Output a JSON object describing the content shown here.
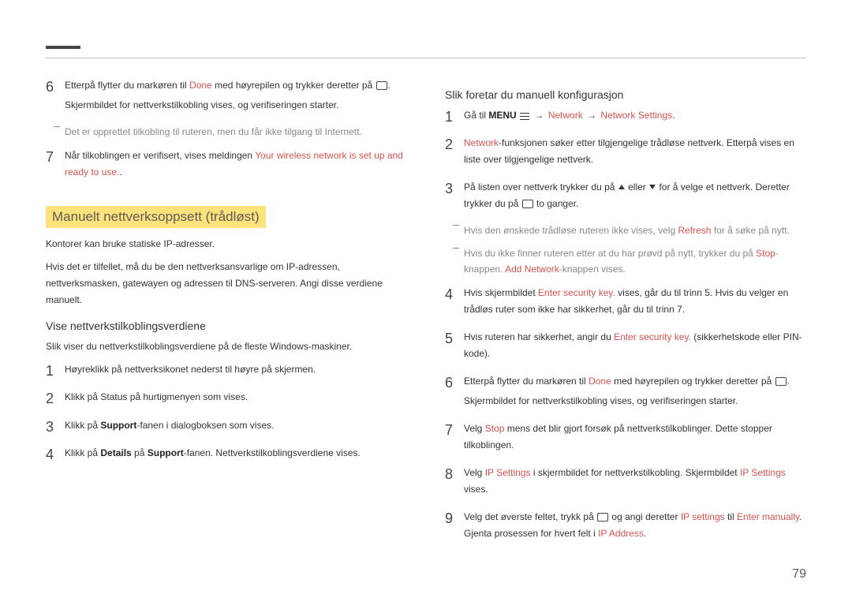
{
  "pageNumber": "79",
  "left": {
    "steps_a": [
      {
        "n": "6",
        "parts": [
          {
            "t": "Etterpå flytter du markøren til "
          },
          {
            "t": "Done",
            "hi": true
          },
          {
            "t": " med høyrepilen og trykker deretter på "
          },
          {
            "icon": "enter"
          },
          {
            "t": "."
          }
        ],
        "extra": "Skjermbildet for nettverkstilkobling vises, og verifiseringen starter.",
        "note": "Det er opprettet tilkobling til ruteren, men du får ikke tilgang til Internett."
      },
      {
        "n": "7",
        "parts": [
          {
            "t": "Når tilkoblingen er verifisert, vises meldingen "
          },
          {
            "t": "Your wireless network is set up and ready to use.",
            "hi": true
          },
          {
            "t": "."
          }
        ]
      }
    ],
    "section": "Manuelt nettverksoppsett (trådløst)",
    "para1": "Kontorer kan bruke statiske IP-adresser.",
    "para2": "Hvis det er tilfellet, må du be den nettverksansvarlige om IP-adressen, nettverksmasken, gatewayen og adressen til DNS-serveren. Angi disse verdiene manuelt.",
    "sub": "Vise nettverkstilkoblingsverdiene",
    "para3": "Slik viser du nettverkstilkoblingsverdiene på de fleste Windows-maskiner.",
    "steps_b": [
      {
        "n": "1",
        "parts": [
          {
            "t": "Høyreklikk på nettverksikonet nederst til høyre på skjermen."
          }
        ]
      },
      {
        "n": "2",
        "parts": [
          {
            "t": "Klikk på Status på hurtigmenyen som vises."
          }
        ]
      },
      {
        "n": "3",
        "parts": [
          {
            "t": "Klikk på "
          },
          {
            "t": "Support",
            "bold": true
          },
          {
            "t": "-fanen i dialogboksen som vises."
          }
        ]
      },
      {
        "n": "4",
        "parts": [
          {
            "t": "Klikk på "
          },
          {
            "t": "Details",
            "bold": true
          },
          {
            "t": " på "
          },
          {
            "t": "Support",
            "bold": true
          },
          {
            "t": "-fanen. Nettverkstilkoblingsverdiene vises."
          }
        ]
      }
    ]
  },
  "right": {
    "sub": "Slik foretar du manuell konfigurasjon",
    "steps": [
      {
        "n": "1",
        "parts": [
          {
            "t": "Gå til "
          },
          {
            "t": "MENU",
            "bold": true
          },
          {
            "t": " "
          },
          {
            "icon": "menu"
          },
          {
            "t": " "
          },
          {
            "arrow": true
          },
          {
            "t": " "
          },
          {
            "t": "Network",
            "hi": true
          },
          {
            "t": " "
          },
          {
            "arrow": true
          },
          {
            "t": " "
          },
          {
            "t": "Network Settings",
            "hi": true
          },
          {
            "t": "."
          }
        ]
      },
      {
        "n": "2",
        "parts": [
          {
            "t": "Network",
            "hi": true
          },
          {
            "t": "-funksjonen søker etter tilgjengelige trådløse nettverk. Etterpå vises en liste over tilgjengelige nettverk."
          }
        ]
      },
      {
        "n": "3",
        "parts": [
          {
            "t": "På listen over nettverk trykker du på "
          },
          {
            "icon": "up"
          },
          {
            "t": " eller "
          },
          {
            "icon": "down"
          },
          {
            "t": " for å velge et nettverk. Deretter trykker du på "
          },
          {
            "icon": "enter"
          },
          {
            "t": " to ganger."
          }
        ],
        "notes": [
          {
            "parts": [
              {
                "t": "Hvis den ønskede trådløse ruteren ikke vises, velg "
              },
              {
                "t": "Refresh",
                "hi": true
              },
              {
                "t": " for å søke på nytt."
              }
            ]
          },
          {
            "parts": [
              {
                "t": "Hvis du ikke finner ruteren etter at du har prøvd på nytt, trykker du på "
              },
              {
                "t": "Stop",
                "hi": true
              },
              {
                "t": "-knappen. "
              },
              {
                "t": "Add Network",
                "hi": true
              },
              {
                "t": "-knappen vises."
              }
            ]
          }
        ]
      },
      {
        "n": "4",
        "parts": [
          {
            "t": "Hvis skjermbildet "
          },
          {
            "t": "Enter security key.",
            "hi": true
          },
          {
            "t": " vises, går du til trinn 5. Hvis du velger en trådløs ruter som ikke har sikkerhet, går du til trinn 7."
          }
        ]
      },
      {
        "n": "5",
        "parts": [
          {
            "t": "Hvis ruteren har sikkerhet, angir du "
          },
          {
            "t": "Enter security key.",
            "hi": true
          },
          {
            "t": " (sikkerhetskode eller PIN-kode)."
          }
        ]
      },
      {
        "n": "6",
        "parts": [
          {
            "t": "Etterpå flytter du markøren til "
          },
          {
            "t": "Done",
            "hi": true
          },
          {
            "t": " med høyrepilen og trykker deretter på "
          },
          {
            "icon": "enter"
          },
          {
            "t": "."
          }
        ],
        "extra": "Skjermbildet for nettverkstilkobling vises, og verifiseringen starter."
      },
      {
        "n": "7",
        "parts": [
          {
            "t": "Velg "
          },
          {
            "t": "Stop",
            "hi": true
          },
          {
            "t": " mens det blir gjort forsøk på nettverkstilkoblinger. Dette stopper tilkoblingen."
          }
        ]
      },
      {
        "n": "8",
        "parts": [
          {
            "t": "Velg "
          },
          {
            "t": "IP Settings",
            "hi": true
          },
          {
            "t": " i skjermbildet for nettverkstilkobling. Skjermbildet "
          },
          {
            "t": "IP Settings",
            "hi": true
          },
          {
            "t": " vises."
          }
        ]
      },
      {
        "n": "9",
        "parts": [
          {
            "t": "Velg det øverste feltet, trykk på "
          },
          {
            "icon": "enter"
          },
          {
            "t": " og angi deretter "
          },
          {
            "t": "IP settings",
            "hi": true
          },
          {
            "t": " til "
          },
          {
            "t": "Enter manually",
            "hi": true
          },
          {
            "t": ". Gjenta prosessen for hvert felt i "
          },
          {
            "t": "IP Address",
            "hi": true
          },
          {
            "t": "."
          }
        ]
      }
    ]
  }
}
